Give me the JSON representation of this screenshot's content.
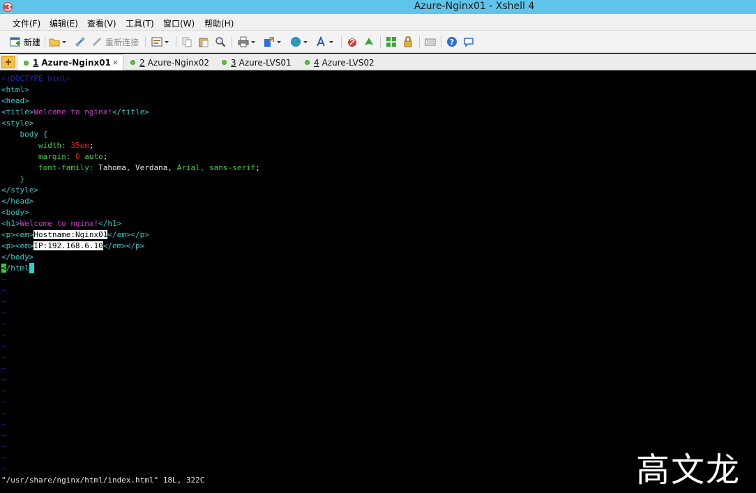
{
  "window": {
    "title": "Azure-Nginx01 - Xshell 4"
  },
  "menu": [
    "文件(F)",
    "编辑(E)",
    "查看(V)",
    "工具(T)",
    "窗口(W)",
    "帮助(H)"
  ],
  "toolbar": {
    "new_label": "新建",
    "reconnect_label": "重新连接"
  },
  "tabs": [
    {
      "num": "1",
      "label": "Azure-Nginx01",
      "active": true
    },
    {
      "num": "2",
      "label": "Azure-Nginx02"
    },
    {
      "num": "3",
      "label": "Azure-LVS01"
    },
    {
      "num": "4",
      "label": "Azure-LVS02"
    }
  ],
  "tab_close": "×",
  "terminal": {
    "doctype": "<!DOCTYPE html>",
    "html_open": "<html>",
    "head_open": "<head>",
    "title_open": "<title>",
    "title_text": "Welcome to nginx!",
    "title_close": "</title>",
    "style_open": "<style>",
    "body_sel": "    body {",
    "width_prop": "        width:",
    "width_val": " 35em",
    "margin_prop": "        margin:",
    "margin_zero": " 0",
    "margin_auto": " auto",
    "font_prop": "        font-family:",
    "font_a": " Tahoma, Verdana,",
    "font_b": " Arial,",
    "font_c": " sans-serif",
    "semicolon": ";",
    "brace_close": "    }",
    "style_close": "</style>",
    "head_close": "</head>",
    "body_open": "<body>",
    "h1_open": "<h1>",
    "h1_text": "Welcome to nginx!",
    "h1_close": "</h1>",
    "p_em_open": "<p><em>",
    "hostname_text": "Hostname:Nginx01",
    "em_p_close": "</em></p>",
    "ip_text": "IP:192.168.6.10",
    "body_close": "</body>",
    "html_close_first": "<",
    "html_close_rest": "/html",
    "tilde": "~",
    "status": "\"/usr/share/nginx/html/index.html\" 18L, 322C"
  },
  "watermark": "高文龙",
  "colors": {
    "title_bar": "#5ec4ea",
    "tag": "#33c9c9",
    "text": "#d13fd1",
    "property": "#3fcf3f",
    "number": "#d02b2b"
  }
}
